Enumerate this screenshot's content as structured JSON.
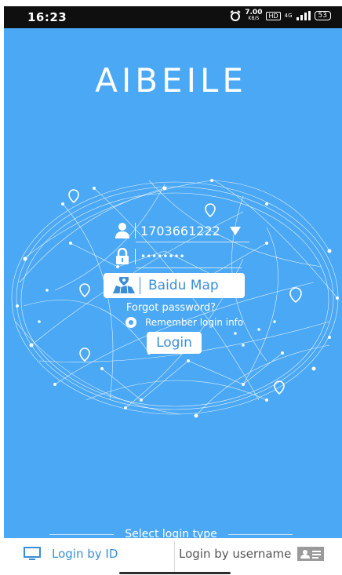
{
  "status_bar": {
    "time": "16:23",
    "net_speed_value": "7.00",
    "net_speed_unit": "KB/S",
    "hd_badge": "HD",
    "signal_label": "4G",
    "battery": "53"
  },
  "app": {
    "title": "AIBEILE"
  },
  "login_form": {
    "account_value": "1703661222",
    "password_mask": "••••••••",
    "map_button_label": "Baidu Map",
    "forgot_password_label": "Forgot password?",
    "remember_label": "Remember login info",
    "remember_checked": true,
    "login_button_label": "Login"
  },
  "login_type": {
    "section_label": "Select login type",
    "tabs": [
      {
        "label": "Login by ID",
        "icon": "monitor-icon",
        "selected": true
      },
      {
        "label": "Login by username",
        "icon": "id-card-icon",
        "selected": false
      }
    ]
  },
  "colors": {
    "background": "#4aa8f4",
    "accent": "#3a8fd8",
    "text_on_accent": "#ffffff"
  }
}
